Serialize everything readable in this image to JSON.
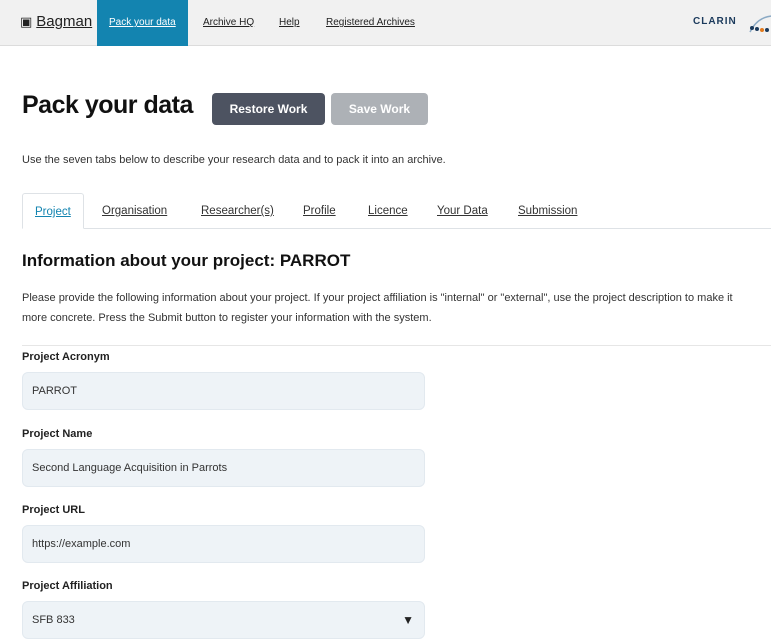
{
  "navbar": {
    "brand_icon": "briefcase-icon",
    "brand": "Bagman",
    "items": [
      {
        "label": "Pack your data",
        "active": true
      },
      {
        "label": "Archive HQ",
        "active": false
      },
      {
        "label": "Help",
        "active": false
      },
      {
        "label": "Registered Archives",
        "active": false
      }
    ],
    "partner": "CLARIN",
    "partner_icon": "clarin-logo-icon"
  },
  "page": {
    "title": "Pack your data",
    "restore_label": "Restore Work",
    "save_label": "Save Work",
    "intro": "Use the seven tabs below to describe your research data and to pack it into an archive."
  },
  "tabs": [
    {
      "label": "Project",
      "active": true
    },
    {
      "label": "Organisation",
      "active": false
    },
    {
      "label": "Researcher(s)",
      "active": false
    },
    {
      "label": "Profile",
      "active": false
    },
    {
      "label": "Licence",
      "active": false
    },
    {
      "label": "Your Data",
      "active": false
    },
    {
      "label": "Submission",
      "active": false
    }
  ],
  "section": {
    "title": "Information about your project: PARROT",
    "description": "Please provide the following information about your project. If your project affiliation is \"internal\" or \"external\", use the project description to make it more concrete. Press the Submit button to register your information with the system."
  },
  "form": {
    "acronym": {
      "label": "Project Acronym",
      "value": "PARROT"
    },
    "name": {
      "label": "Project Name",
      "value": "Second Language Acquisition in Parrots"
    },
    "url": {
      "label": "Project URL",
      "value": "https://example.com"
    },
    "affiliation": {
      "label": "Project Affiliation",
      "value": "SFB 833",
      "caret_icon": "caret-down-icon"
    }
  },
  "colors": {
    "accent": "#1384b0",
    "restore_button": "#4d5361",
    "save_button_disabled": "#adb1b6",
    "input_background": "#eef3f7"
  }
}
